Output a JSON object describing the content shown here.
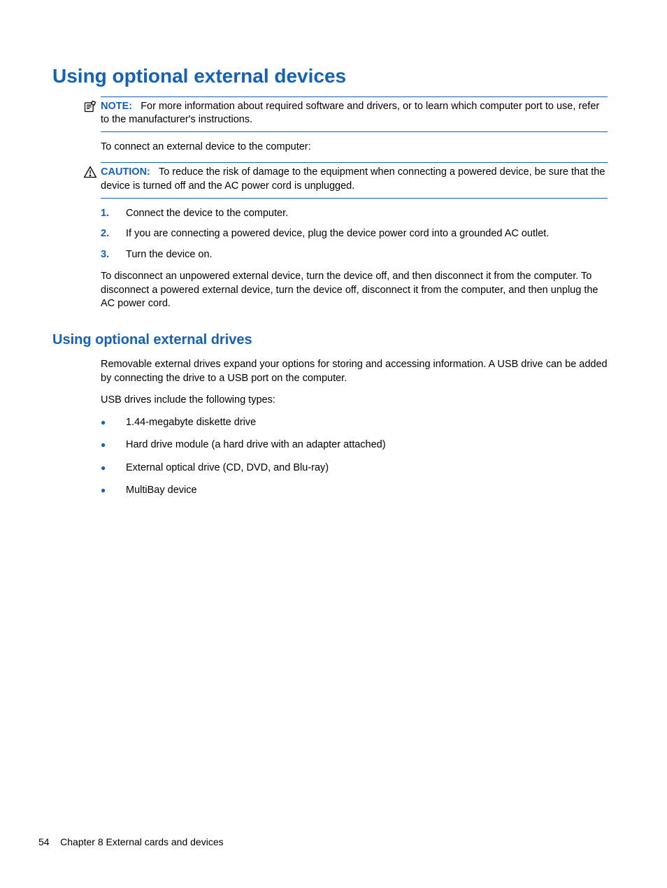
{
  "title": "Using optional external devices",
  "note": {
    "label": "NOTE:",
    "text": "For more information about required software and drivers, or to learn which computer port to use, refer to the manufacturer's instructions."
  },
  "intro": "To connect an external device to the computer:",
  "caution": {
    "label": "CAUTION:",
    "text": "To reduce the risk of damage to the equipment when connecting a powered device, be sure that the device is turned off and the AC power cord is unplugged."
  },
  "steps": [
    "Connect the device to the computer.",
    "If you are connecting a powered device, plug the device power cord into a grounded AC outlet.",
    "Turn the device on."
  ],
  "disconnect": "To disconnect an unpowered external device, turn the device off, and then disconnect it from the computer. To disconnect a powered external device, turn the device off, disconnect it from the computer, and then unplug the AC power cord.",
  "h2": "Using optional external drives",
  "drives_intro": "Removable external drives expand your options for storing and accessing information. A USB drive can be added by connecting the drive to a USB port on the computer.",
  "drives_sub": "USB drives include the following types:",
  "bullets": [
    "1.44-megabyte diskette drive",
    "Hard drive module (a hard drive with an adapter attached)",
    "External optical drive (CD, DVD, and Blu-ray)",
    "MultiBay device"
  ],
  "footer": {
    "page": "54",
    "chapter": "Chapter 8   External cards and devices"
  }
}
